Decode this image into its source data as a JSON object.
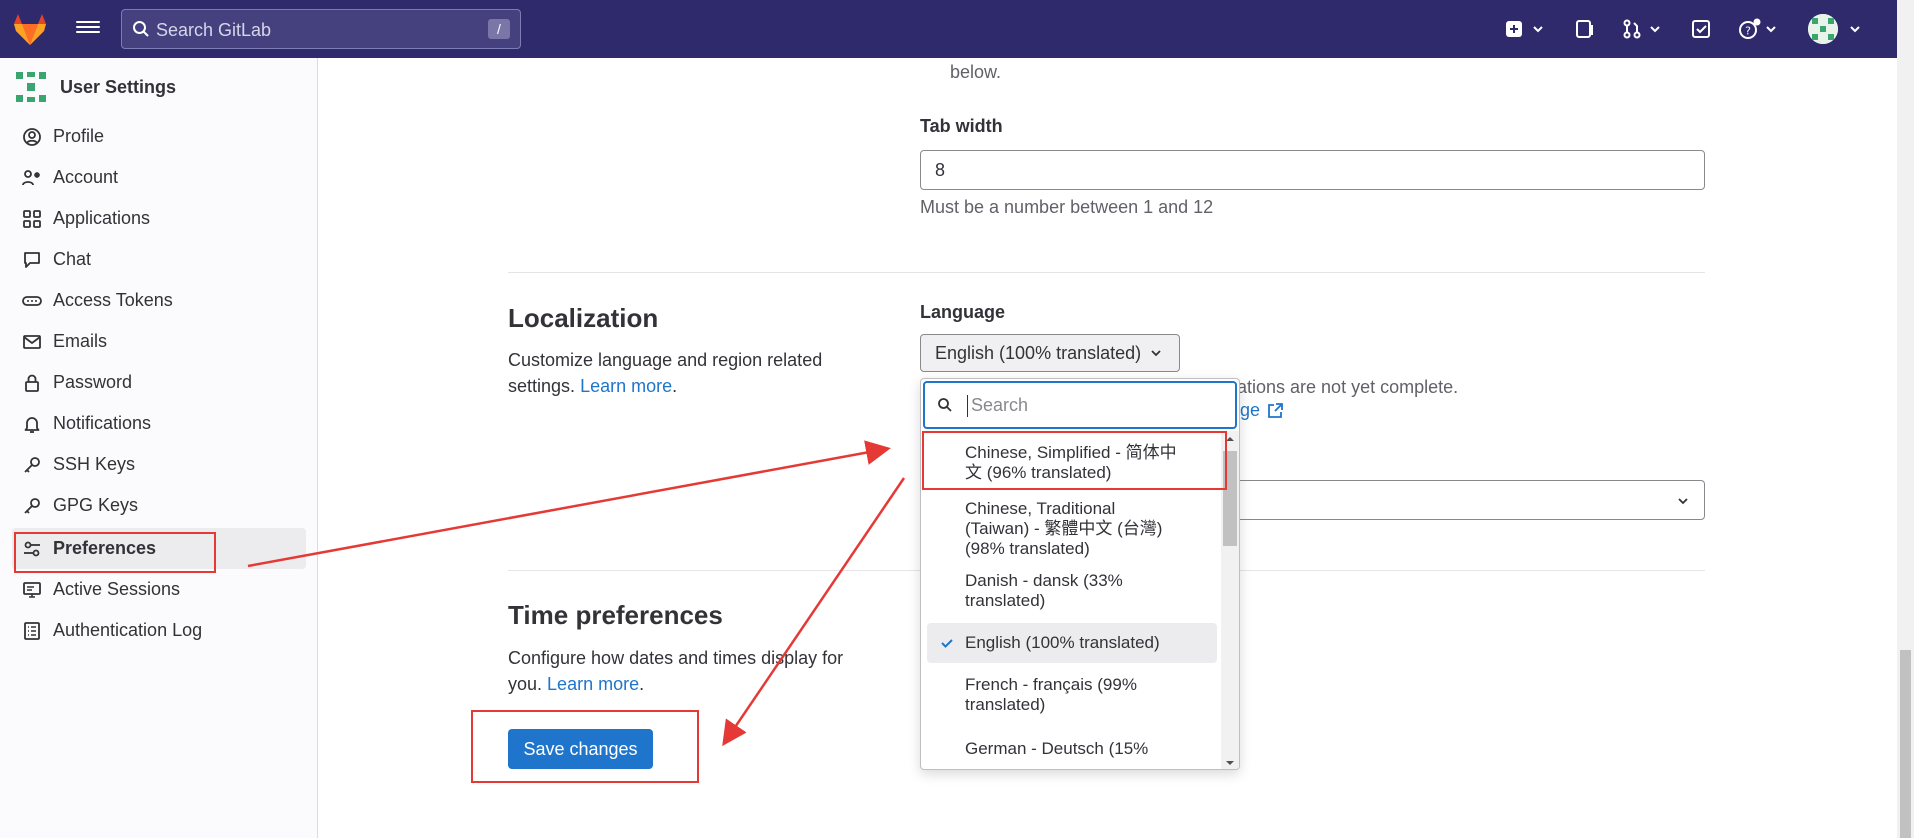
{
  "topbar": {
    "search_placeholder": "Search GitLab",
    "search_shortcut": "/"
  },
  "sidebar": {
    "title": "User Settings",
    "items": [
      {
        "label": "Profile",
        "icon": "profile-icon"
      },
      {
        "label": "Account",
        "icon": "account-icon"
      },
      {
        "label": "Applications",
        "icon": "applications-icon"
      },
      {
        "label": "Chat",
        "icon": "chat-icon"
      },
      {
        "label": "Access Tokens",
        "icon": "token-icon"
      },
      {
        "label": "Emails",
        "icon": "mail-icon"
      },
      {
        "label": "Password",
        "icon": "lock-icon"
      },
      {
        "label": "Notifications",
        "icon": "bell-icon"
      },
      {
        "label": "SSH Keys",
        "icon": "key-icon"
      },
      {
        "label": "GPG Keys",
        "icon": "key-icon"
      },
      {
        "label": "Preferences",
        "icon": "preferences-icon",
        "active": true
      },
      {
        "label": "Active Sessions",
        "icon": "monitor-icon"
      },
      {
        "label": "Authentication Log",
        "icon": "log-icon"
      }
    ]
  },
  "behavior": {
    "top_partial_text": "below.",
    "tab_width_label": "Tab width",
    "tab_width_value": "8",
    "tab_width_help": "Must be a number between 1 and 12"
  },
  "localization": {
    "heading": "Localization",
    "description": "Customize language and region related settings.",
    "learn_more": "Learn more",
    "language_label": "Language",
    "language_value": "English (100% translated)",
    "help_partial": "ations are not yet complete.",
    "help_link_partial": "ge"
  },
  "time": {
    "heading": "Time preferences",
    "description": "Configure how dates and times display for you.",
    "learn_more": "Learn more"
  },
  "save_label": "Save changes",
  "dropdown": {
    "search_placeholder": "Search",
    "items": [
      {
        "line1": "Chinese, Simplified - 简体中",
        "line2": "文 (96% translated)",
        "line3": ""
      },
      {
        "line1": "Chinese, Traditional",
        "line2": "(Taiwan) - 繁體中文 (台灣)",
        "line3": "(98% translated)"
      },
      {
        "line1": "Danish - dansk (33%",
        "line2": "translated)",
        "line3": ""
      },
      {
        "line1": "English (100% translated)",
        "line2": "",
        "line3": "",
        "selected": true
      },
      {
        "line1": "French - français (99%",
        "line2": "translated)",
        "line3": ""
      },
      {
        "line1": "German - Deutsch (15%",
        "line2": "",
        "line3": ""
      }
    ]
  },
  "colors": {
    "topbar": "#2f2a6b",
    "link": "#1f75cb",
    "annotation": "#e53935"
  }
}
